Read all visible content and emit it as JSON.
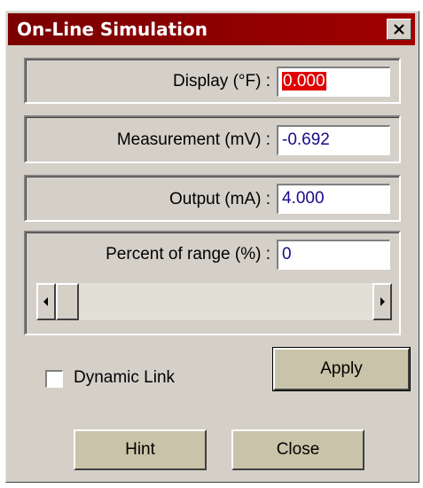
{
  "window": {
    "title": "On-Line Simulation",
    "close_glyph": "✕"
  },
  "fields": {
    "display": {
      "label": "Display (°F) :",
      "value": "0.000"
    },
    "measurement": {
      "label": "Measurement (mV) :",
      "value": "-0.692"
    },
    "output": {
      "label": "Output (mA) :",
      "value": "4.000"
    },
    "percent": {
      "label": "Percent of range (%) :",
      "value": "0"
    }
  },
  "scrollbar": {
    "value_percent": 0,
    "left_arrow": "◂",
    "right_arrow": "▸"
  },
  "dynamic_link": {
    "label": "Dynamic Link",
    "checked": false
  },
  "buttons": {
    "apply": "Apply",
    "hint": "Hint",
    "close": "Close"
  },
  "colors": {
    "titlebar": "#8b0000",
    "selection": "#e00000",
    "field_text": "#1a0a8a",
    "button_face": "#c9c3a9"
  }
}
